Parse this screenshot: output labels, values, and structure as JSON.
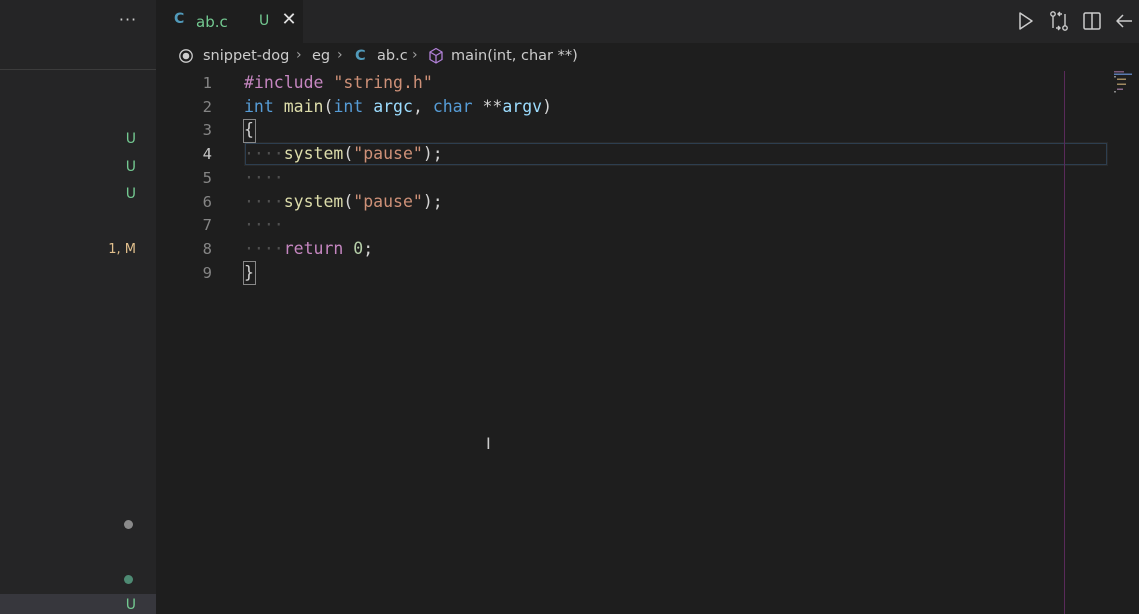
{
  "sidebar": {
    "more_label": "···",
    "badges": [
      {
        "text": "U",
        "kind": "u"
      },
      {
        "text": "U",
        "kind": "u"
      },
      {
        "text": "U",
        "kind": "u"
      },
      {
        "text": "1, M",
        "kind": "m"
      }
    ],
    "bottom_badge": "U",
    "dot_colors": [
      "#8a8a8a",
      "#4e8a73"
    ]
  },
  "tab": {
    "icon_letter": "C",
    "label": "ab.c",
    "status": "U",
    "close_glyph": "✕"
  },
  "toolbar": {
    "actions": [
      "run-icon",
      "compare-changes-icon",
      "split-editor-icon",
      "go-back-icon"
    ]
  },
  "breadcrumb": {
    "root": "snippet-dog",
    "folder": "eg",
    "file_icon": "C",
    "file": "ab.c",
    "symbol": "main(int, char **)"
  },
  "editor": {
    "line_numbers": [
      "1",
      "2",
      "3",
      "4",
      "5",
      "6",
      "7",
      "8",
      "9"
    ],
    "current_line": "4",
    "lines": {
      "l1_directive": "#include",
      "l1_header": "\"string.h\"",
      "l2_type1": "int",
      "l2_fn": "main",
      "l2_open": "(",
      "l2_type2": "int",
      "l2_arg1": "argc",
      "l2_comma": ", ",
      "l2_type3": "char",
      "l2_stars": " **",
      "l2_arg2": "argv",
      "l2_close": ")",
      "l3": "{",
      "l4_ws": "····",
      "l4_fn": "system",
      "l4_open": "(",
      "l4_str": "\"pause\"",
      "l4_close": ");",
      "l5_ws": "····",
      "l6_ws": "····",
      "l6_fn": "system",
      "l6_open": "(",
      "l6_str": "\"pause\"",
      "l6_close": ");",
      "l7_ws": "····",
      "l8_ws": "····",
      "l8_kw": "return",
      "l8_num": "0",
      "l8_end": ";",
      "l9": "}"
    }
  },
  "colors": {
    "editor_bg": "#1e1e1e",
    "sidebar_bg": "#252526",
    "untracked": "#73c991",
    "modified": "#e2c08d",
    "keyword": "#569cd6",
    "control": "#c586c0",
    "function": "#dcdcaa",
    "string": "#ce9178",
    "variable": "#9cdcfe"
  }
}
